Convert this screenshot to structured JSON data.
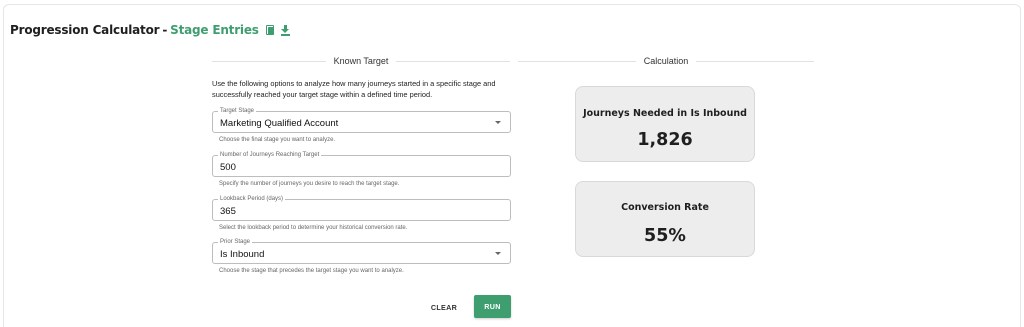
{
  "header": {
    "title": "Progression Calculator",
    "separator": "-",
    "subtitle": "Stage Entries",
    "icons": [
      "copy-icon",
      "download-icon"
    ]
  },
  "known_target": {
    "title": "Known Target",
    "description": "Use the following options to analyze how many journeys started in a specific stage and successfully reached your target stage within a defined time period.",
    "fields": [
      {
        "label": "Target Stage",
        "value": "Marketing Qualified Account",
        "helper": "Choose the final stage you want to analyze.",
        "type": "select"
      },
      {
        "label": "Number of Journeys Reaching Target",
        "value": "500",
        "helper": "Specify the number of journeys you desire to reach the target stage.",
        "type": "input"
      },
      {
        "label": "Lookback Period (days)",
        "value": "365",
        "helper": "Select the lookback period to determine your historical conversion rate.",
        "type": "input"
      },
      {
        "label": "Prior Stage",
        "value": "Is Inbound",
        "helper": "Choose the stage that precedes the target stage you want to analyze.",
        "type": "select"
      }
    ],
    "clear_label": "CLEAR",
    "run_label": "RUN"
  },
  "calculation": {
    "title": "Calculation",
    "stats": [
      {
        "title": "Journeys Needed in Is Inbound",
        "value": "1,826"
      },
      {
        "title": "Conversion Rate",
        "value": "55%"
      }
    ]
  },
  "colors": {
    "accent": "#3f9e6f",
    "card_bg": "#ededed"
  }
}
